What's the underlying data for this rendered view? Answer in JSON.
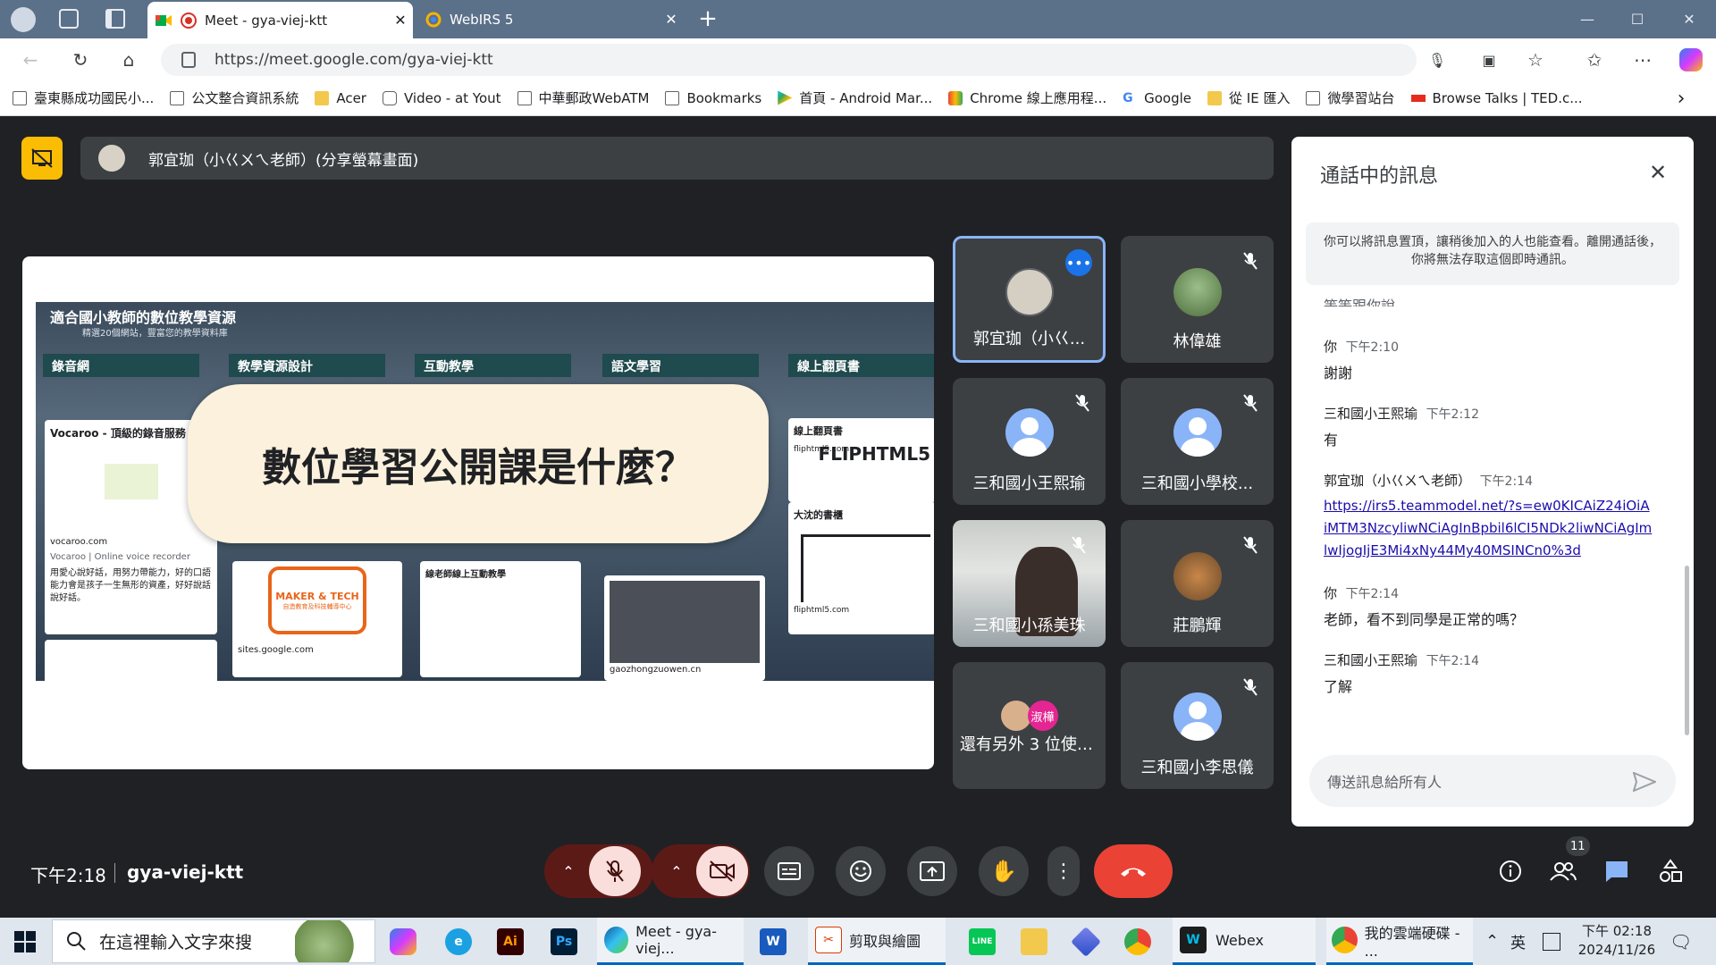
{
  "browser": {
    "tabs": [
      {
        "title": "Meet - gya-viej-ktt"
      },
      {
        "title": "WebIRS 5"
      }
    ],
    "url": "https://meet.google.com/gya-viej-ktt",
    "bookmarks": [
      "臺東縣成功國民小...",
      "公文整合資訊系統",
      "Acer",
      "Video - at Yout",
      "中華郵政WebATM",
      "Bookmarks",
      "首頁 - Android Mar...",
      "Chrome 線上應用程...",
      "Google",
      "從 IE 匯入",
      "微學習站台",
      "Browse Talks | TED.c..."
    ]
  },
  "meet": {
    "presenter_label": "郭宜珈（小巜ㄨㄟ老師）(分享螢幕畫面)",
    "slide": {
      "title": "適合國小教師的數位教學資源",
      "subtitle": "精選20個網站，豐富您的教學資料庫",
      "columns": [
        "錄音網",
        "教學資源設計",
        "互動教學",
        "語文學習",
        "線上翻頁書"
      ],
      "card1_title": "Vocaroo - 頂級的錄音服務",
      "card1_site": "vocaroo.com",
      "card1_sub": "Vocaroo | Online voice recorder",
      "card1_text": "用愛心說好話，用努力帶能力，好的口語能力會是孩子一生無形的資產，好好說話說好話。",
      "card2_logo": "MAKER & TECH",
      "card2_sub": "自造教育及科技輔導中心",
      "card2_site": "sites.google.com",
      "card3_title": "線老師線上互動教學",
      "card4_site": "gaozhongzuowen.cn",
      "card5_title": "線上翻頁書",
      "card5_site": "fliphtml5.com",
      "card5_logo": "FLIPHTML5",
      "card6_title": "大沈的書櫃",
      "card6_site": "fliphtml5.com",
      "banner": "數位學習公開課是什麼？"
    },
    "participants": [
      {
        "name": "郭宜珈（小巜...",
        "type": "drawn",
        "muted": false,
        "active": true
      },
      {
        "name": "林偉雄",
        "type": "photo",
        "muted": true
      },
      {
        "name": "三和國小王熙瑜",
        "type": "default",
        "muted": true
      },
      {
        "name": "三和國小學校...",
        "type": "default",
        "muted": true
      },
      {
        "name": "三和國小孫美珠",
        "type": "video",
        "muted": true
      },
      {
        "name": "莊鵬輝",
        "type": "photo",
        "muted": true
      },
      {
        "name": "還有另外 3 位使用者",
        "type": "group",
        "badge": "淑樺"
      },
      {
        "name": "三和國小李思儀",
        "type": "default",
        "muted": true
      }
    ],
    "time": "下午2:18",
    "code": "gya-viej-ktt",
    "participant_count": "11"
  },
  "chat": {
    "title": "通話中的訊息",
    "notice": "你可以將訊息置頂，讓稍後加入的人也能查看。離開通話後，你將無法存取這個即時通訊。",
    "partial": "等等跟你說",
    "messages": [
      {
        "sender": "你",
        "time": "下午2:10",
        "text": "謝謝"
      },
      {
        "sender": "三和國小王熙瑜",
        "time": "下午2:12",
        "text": "有"
      },
      {
        "sender": "郭宜珈（小巜ㄨㄟ老師）",
        "time": "下午2:14",
        "text": "https://irs5.teammodel.net/?s=ew0KICAiZ24iOiAiMTM3NzcyliwNCiAgInBpbil6lCI5NDk2liwNCiAgImlwIjogIjE3Mi4xNy44My40MSINCn0%3d",
        "link": true
      },
      {
        "sender": "你",
        "time": "下午2:14",
        "text": "老師，看不到同學是正常的嗎？"
      },
      {
        "sender": "三和國小王熙瑜",
        "time": "下午2:14",
        "text": "了解"
      }
    ],
    "input_placeholder": "傳送訊息給所有人"
  },
  "taskbar": {
    "search_placeholder": "在這裡輸入文字來搜",
    "apps": [
      "Meet - gya-viej...",
      "剪取與繪圖",
      "Webex",
      "我的雲端硬碟 - ..."
    ],
    "ime": "英",
    "clock_time": "下午 02:18",
    "clock_date": "2024/11/26"
  }
}
